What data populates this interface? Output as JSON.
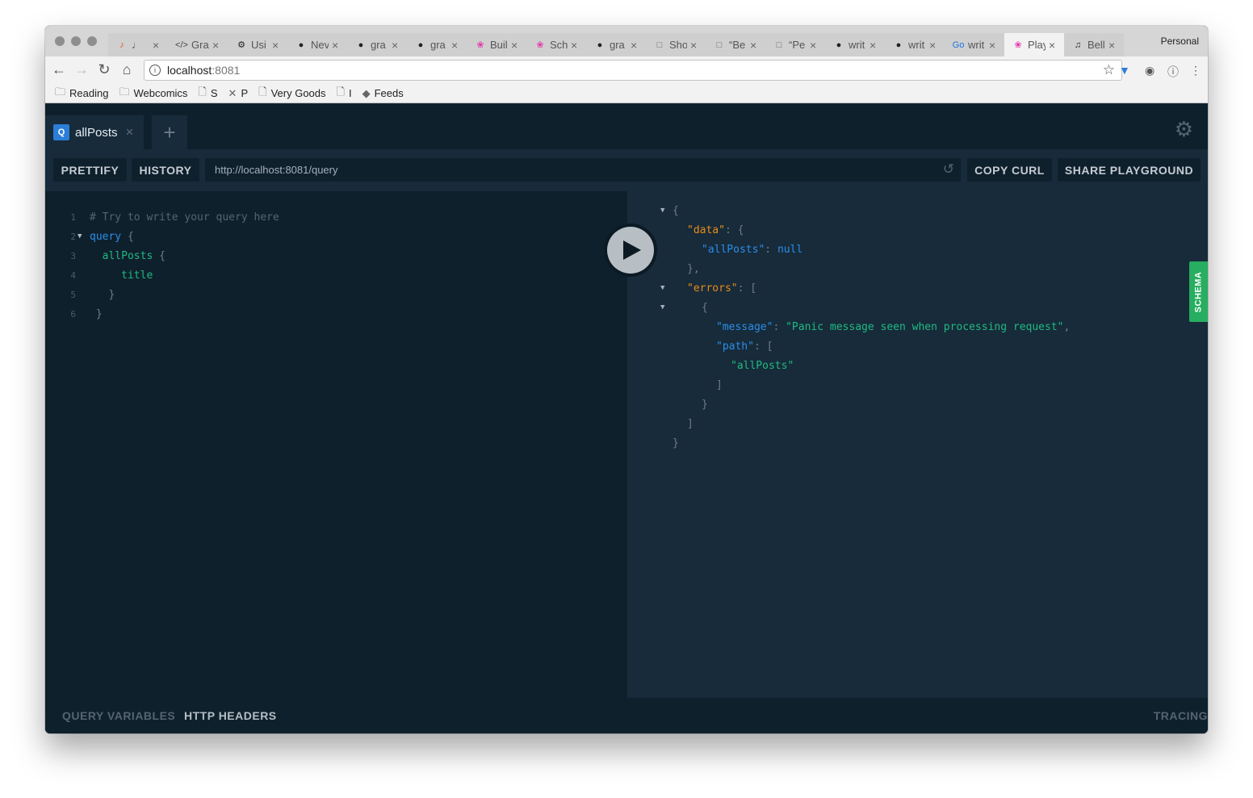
{
  "browser": {
    "profile": "Personal",
    "tabs": [
      {
        "label": "♩",
        "fav": "♪",
        "favcolor": "#e8541c"
      },
      {
        "label": "Gra",
        "fav": "</>",
        "favcolor": "#444"
      },
      {
        "label": "Usi",
        "fav": "⚙",
        "favcolor": "#222"
      },
      {
        "label": "Nev",
        "fav": "●",
        "favcolor": "#222"
      },
      {
        "label": "gra",
        "fav": "●",
        "favcolor": "#222"
      },
      {
        "label": "gra",
        "fav": "●",
        "favcolor": "#222"
      },
      {
        "label": "Buil",
        "fav": "❀",
        "favcolor": "#e535ab"
      },
      {
        "label": "Sch",
        "fav": "❀",
        "favcolor": "#e535ab"
      },
      {
        "label": "gra",
        "fav": "●",
        "favcolor": "#222"
      },
      {
        "label": "Sho",
        "fav": "□",
        "favcolor": "#666"
      },
      {
        "label": "“Be",
        "fav": "□",
        "favcolor": "#666"
      },
      {
        "label": "“Pe",
        "fav": "□",
        "favcolor": "#666"
      },
      {
        "label": "writ",
        "fav": "●",
        "favcolor": "#222"
      },
      {
        "label": "writ",
        "fav": "●",
        "favcolor": "#222"
      },
      {
        "label": "writ",
        "fav": "Go",
        "favcolor": "#1a73e8"
      },
      {
        "label": "Play",
        "fav": "❀",
        "favcolor": "#e535ab",
        "active": true
      },
      {
        "label": "Bell",
        "fav": "♫",
        "favcolor": "#222"
      }
    ],
    "tab_close": "×",
    "address": {
      "host": "localhost",
      "port": ":8081"
    },
    "bookmarks": [
      {
        "label": "Reading",
        "icon": "🗀"
      },
      {
        "label": "Webcomics",
        "icon": "🗀"
      },
      {
        "label": "S",
        "icon": "🗋"
      },
      {
        "label": "P",
        "icon": "✕"
      },
      {
        "label": "Very Goods",
        "icon": "🗋"
      },
      {
        "label": "I",
        "icon": "🗋"
      },
      {
        "label": "Feeds",
        "icon": "◆"
      }
    ]
  },
  "playground": {
    "query_tab": {
      "badge": "Q",
      "label": "allPosts",
      "close": "×"
    },
    "add_tab": "+",
    "prettify": "PRETTIFY",
    "history": "HISTORY",
    "endpoint": "http://localhost:8081/query",
    "copy_curl": "COPY CURL",
    "share": "SHARE PLAYGROUND",
    "schema": "SCHEMA",
    "editor_lines": [
      {
        "num": "1",
        "fold": false,
        "tokens": [
          {
            "t": "# Try to write your query here",
            "c": "c-comment"
          }
        ]
      },
      {
        "num": "2",
        "fold": true,
        "tokens": [
          {
            "t": "query",
            "c": "c-kw"
          },
          {
            "t": " {",
            "c": "c-punct"
          }
        ]
      },
      {
        "num": "3",
        "fold": false,
        "tokens": [
          {
            "t": "  allPosts",
            "c": "c-field"
          },
          {
            "t": " {",
            "c": "c-punct"
          }
        ]
      },
      {
        "num": "4",
        "fold": false,
        "tokens": [
          {
            "t": "     title",
            "c": "c-field"
          }
        ]
      },
      {
        "num": "5",
        "fold": false,
        "tokens": [
          {
            "t": "   }",
            "c": "c-punct"
          }
        ]
      },
      {
        "num": "6",
        "fold": false,
        "tokens": [
          {
            "t": " }",
            "c": "c-punct"
          }
        ]
      }
    ],
    "result_lines": [
      {
        "fold": true,
        "indent": 0,
        "tokens": [
          {
            "t": "{",
            "c": "c-punct"
          }
        ]
      },
      {
        "fold": false,
        "indent": 1,
        "tokens": [
          {
            "t": "\"data\"",
            "c": "c-key"
          },
          {
            "t": ": {",
            "c": "c-punct"
          }
        ]
      },
      {
        "fold": false,
        "indent": 2,
        "tokens": [
          {
            "t": "\"allPosts\"",
            "c": "c-key2"
          },
          {
            "t": ": ",
            "c": "c-punct"
          },
          {
            "t": "null",
            "c": "c-null"
          }
        ]
      },
      {
        "fold": false,
        "indent": 1,
        "tokens": [
          {
            "t": "},",
            "c": "c-punct"
          }
        ]
      },
      {
        "fold": true,
        "indent": 1,
        "tokens": [
          {
            "t": "\"errors\"",
            "c": "c-key"
          },
          {
            "t": ": [",
            "c": "c-punct"
          }
        ]
      },
      {
        "fold": true,
        "indent": 2,
        "tokens": [
          {
            "t": "{",
            "c": "c-punct"
          }
        ]
      },
      {
        "fold": false,
        "indent": 3,
        "tokens": [
          {
            "t": "\"message\"",
            "c": "c-key2"
          },
          {
            "t": ": ",
            "c": "c-punct"
          },
          {
            "t": "\"Panic message seen when processing request\"",
            "c": "c-str"
          },
          {
            "t": ",",
            "c": "c-punct"
          }
        ]
      },
      {
        "fold": false,
        "indent": 3,
        "tokens": [
          {
            "t": "\"path\"",
            "c": "c-key2"
          },
          {
            "t": ": [",
            "c": "c-punct"
          }
        ]
      },
      {
        "fold": false,
        "indent": 4,
        "tokens": [
          {
            "t": "\"allPosts\"",
            "c": "c-str"
          }
        ]
      },
      {
        "fold": false,
        "indent": 3,
        "tokens": [
          {
            "t": "]",
            "c": "c-punct"
          }
        ]
      },
      {
        "fold": false,
        "indent": 2,
        "tokens": [
          {
            "t": "}",
            "c": "c-punct"
          }
        ]
      },
      {
        "fold": false,
        "indent": 1,
        "tokens": [
          {
            "t": "]",
            "c": "c-punct"
          }
        ]
      },
      {
        "fold": false,
        "indent": 0,
        "tokens": [
          {
            "t": "}",
            "c": "c-punct"
          }
        ]
      }
    ],
    "query_variables": "QUERY VARIABLES",
    "http_headers": "HTTP HEADERS",
    "tracing": "TRACING"
  },
  "colors": {
    "background": "#172b3a",
    "editor_bg": "#0f202d",
    "schema_tab": "#27ae60",
    "key": "#e78c1a",
    "string": "#1fba82",
    "keyword": "#2b8ee8"
  }
}
